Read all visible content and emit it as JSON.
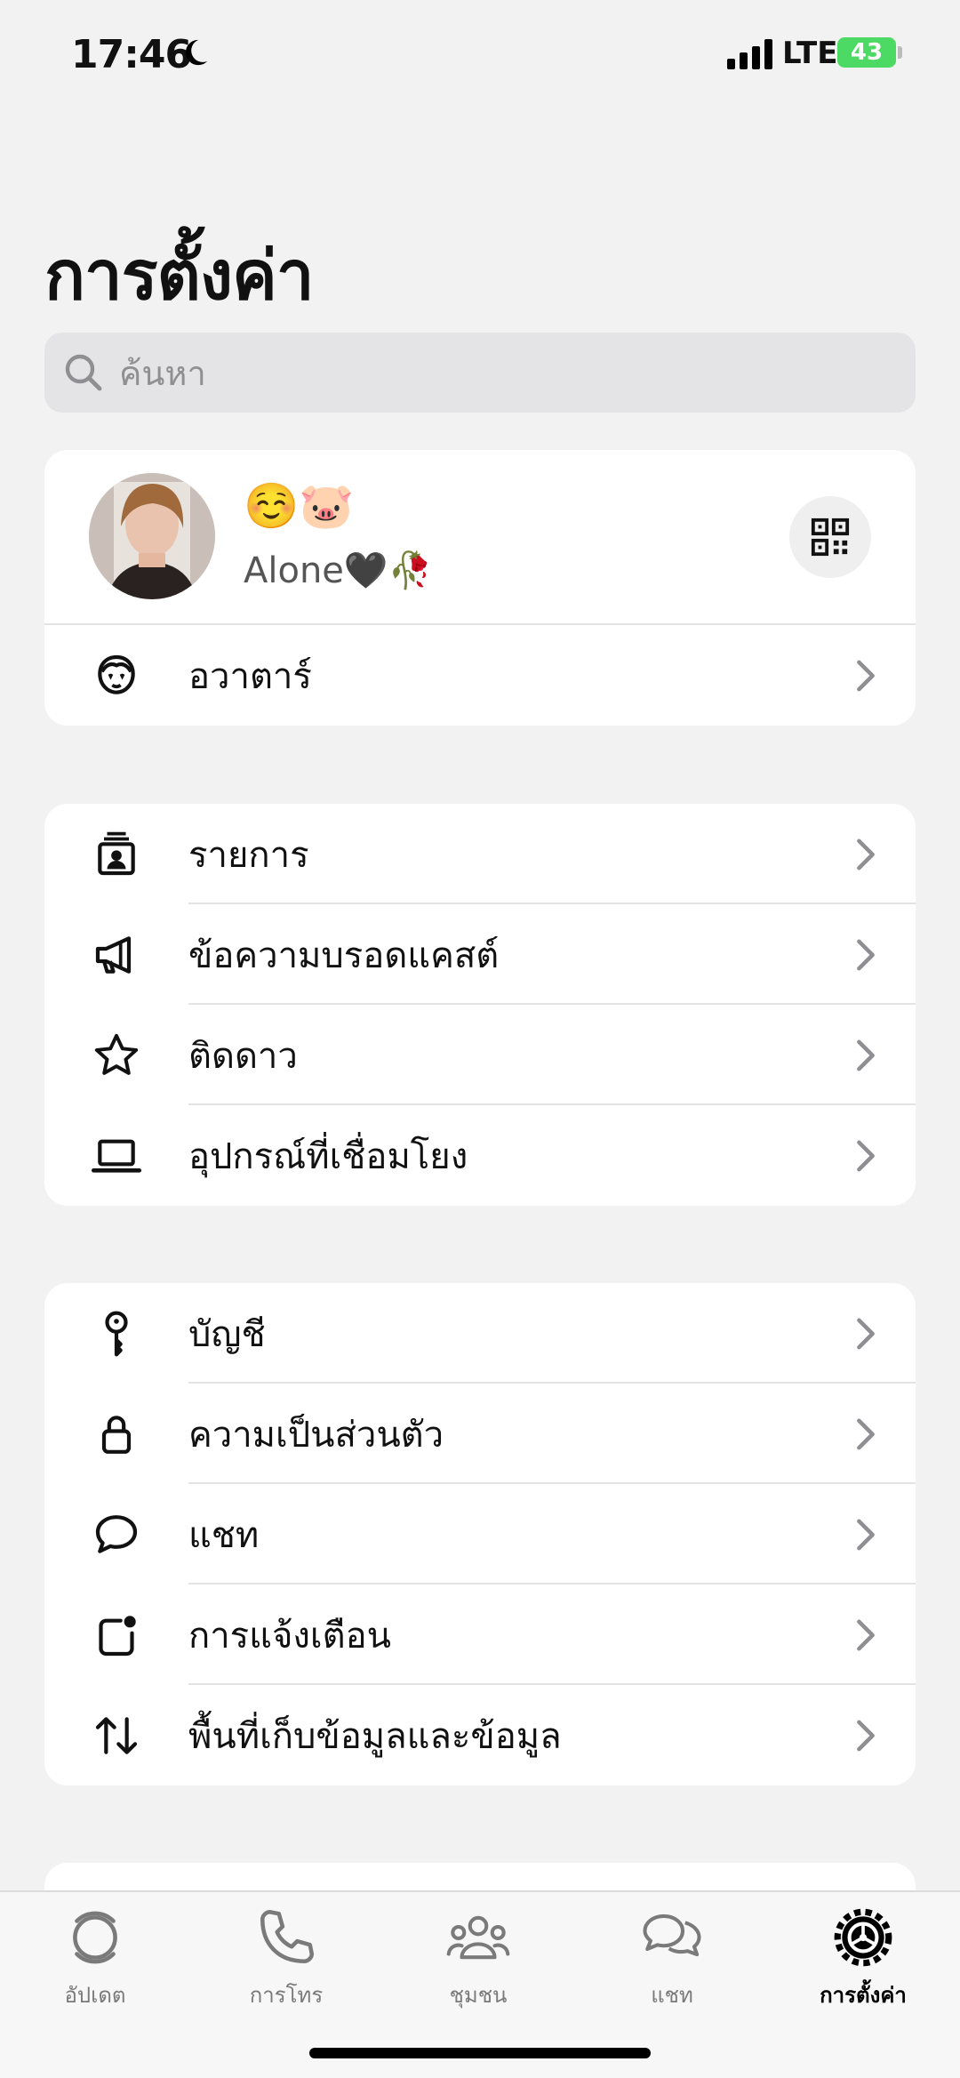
{
  "status_bar": {
    "time": "17:46",
    "network": "LTE",
    "battery": "43"
  },
  "header": {
    "title": "การตั้งค่า"
  },
  "search": {
    "placeholder": "ค้นหา"
  },
  "profile": {
    "name": "☺️🐷",
    "status": "Alone🖤🥀",
    "avatar_row_label": "อวาตาร์"
  },
  "group1": {
    "items": [
      {
        "label": "รายการ",
        "icon": "contacts-list-icon"
      },
      {
        "label": "ข้อความบรอดแคสต์",
        "icon": "megaphone-icon"
      },
      {
        "label": "ติดดาว",
        "icon": "star-icon"
      },
      {
        "label": "อุปกรณ์ที่เชื่อมโยง",
        "icon": "laptop-icon"
      }
    ]
  },
  "group2": {
    "items": [
      {
        "label": "บัญชี",
        "icon": "key-icon"
      },
      {
        "label": "ความเป็นส่วนตัว",
        "icon": "lock-icon"
      },
      {
        "label": "แชท",
        "icon": "chat-bubble-icon"
      },
      {
        "label": "การแจ้งเตือน",
        "icon": "notification-icon"
      },
      {
        "label": "พื้นที่เก็บข้อมูลและข้อมูล",
        "icon": "arrows-updown-icon"
      }
    ]
  },
  "tab_bar": {
    "tabs": [
      {
        "label": "อัปเดต",
        "icon": "updates-icon"
      },
      {
        "label": "การโทร",
        "icon": "phone-icon"
      },
      {
        "label": "ชุมชน",
        "icon": "community-icon"
      },
      {
        "label": "แชท",
        "icon": "chats-icon"
      },
      {
        "label": "การตั้งค่า",
        "icon": "settings-icon",
        "active": true
      }
    ]
  }
}
